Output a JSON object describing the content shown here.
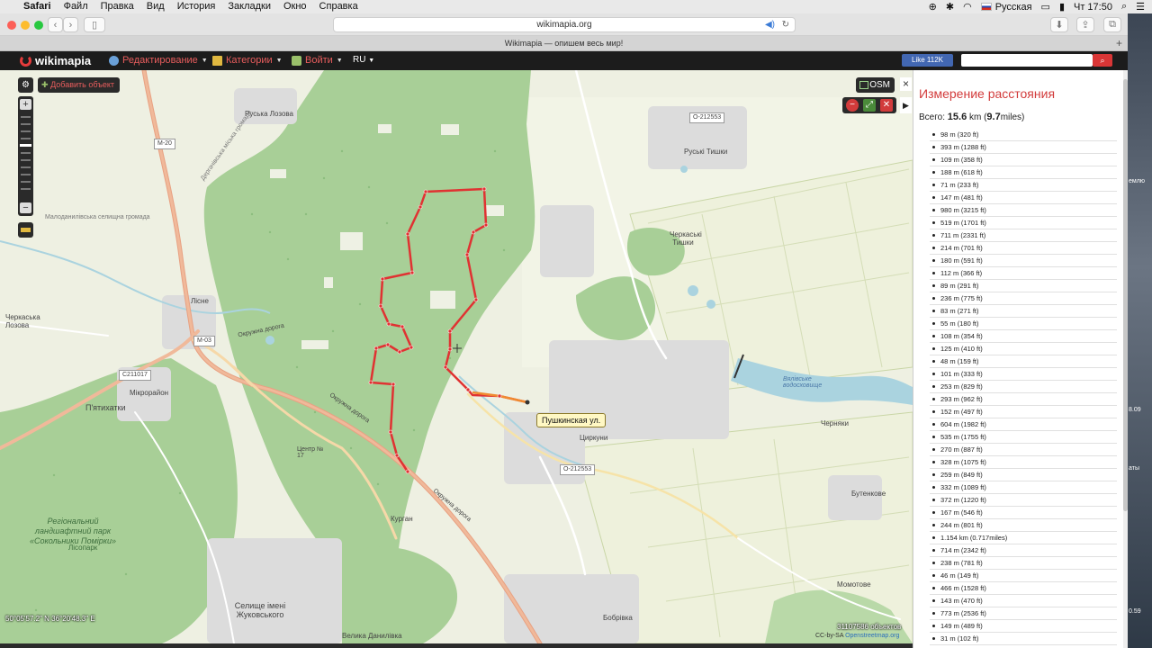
{
  "menubar": {
    "app": "Safari",
    "items": [
      "Файл",
      "Правка",
      "Вид",
      "История",
      "Закладки",
      "Окно",
      "Справка"
    ],
    "input_language": "Русская",
    "clock": "Чт 17:50"
  },
  "browser": {
    "url": "wikimapia.org",
    "tab_title": "Wikimapia — опишем весь мир!"
  },
  "wikimapia": {
    "logo": "wikimapia",
    "menu": [
      {
        "label": "Редактирование",
        "icon": "globe-icon"
      },
      {
        "label": "Категории",
        "icon": "categories-icon"
      },
      {
        "label": "Войти",
        "icon": "login-icon"
      }
    ],
    "lang": "RU",
    "fb_like": "Like 112K",
    "search_placeholder": "",
    "colors": {
      "accent": "#d23b3b",
      "topbar": "#1c1c1c",
      "route": "#e03232",
      "route_segment": "#f08a30",
      "forest": "#7fb27c"
    }
  },
  "map": {
    "add_object": "Добавить объект",
    "osm_button": "OSM",
    "coordinates": "50°05'57.2\" N 36°20'48.3\" E",
    "objects_count": "31107586 объектов",
    "copyright_prefix": "CC-by-SA",
    "copyright_link": "Openstreetmap.org",
    "street_popup": "Пушкинская ул.",
    "labels": {
      "ruska_lozova": "Руська Лозова",
      "m20": "М-20",
      "o212553_top": "О-212553",
      "ruski_tyshky": "Руські Тишки",
      "cherkaski_tyshky": "Черкаські Тишки",
      "malodanylivska": "Малоданилівська селищна громада",
      "derhachi_hromada": "Дергачівська міська громада",
      "lisne": "Лісне",
      "cherkaska_lozova": "Черкаська Лозова",
      "m03": "М-03",
      "c211017": "С211017",
      "mikrorayon": "Мікрорайон",
      "pyatykhatky": "П'ятихатки",
      "okruzhna_1": "Окружна дорога",
      "okruzhna_2": "Окружна дорога",
      "okruzhna_3": "Окружна дорога",
      "tsentr": "Центр № 17",
      "tsyrkuny": "Циркуни",
      "o212553_mid": "О-212553",
      "chernyaky": "Черняки",
      "butenkove": "Бутенкове",
      "momotove": "Момотове",
      "park": "Регіональний ландшафтний парк «Сокольники Помірки»",
      "lisopark": "Лісопарк",
      "kurhan": "Курган",
      "zhukovskoho": "Селище імені Жуковського",
      "velyka_danylivka": "Велика Данилівка",
      "bobrivka": "Бобрівка",
      "reservoir": "Вялівське водосховище"
    }
  },
  "panel": {
    "title": "Измерение расстояния",
    "total_prefix": "Всего: ",
    "total_km": "15.6",
    "total_unit": " km (",
    "total_miles": "9.7",
    "total_suffix": "miles)",
    "segments": [
      "98 m (320 ft)",
      "393 m (1288 ft)",
      "109 m (358 ft)",
      "188 m (618 ft)",
      "71 m (233 ft)",
      "147 m (481 ft)",
      "980 m (3215 ft)",
      "519 m (1701 ft)",
      "711 m (2331 ft)",
      "214 m (701 ft)",
      "180 m (591 ft)",
      "112 m (366 ft)",
      "89 m (291 ft)",
      "236 m (775 ft)",
      "83 m (271 ft)",
      "55 m (180 ft)",
      "108 m (354 ft)",
      "125 m (410 ft)",
      "48 m (159 ft)",
      "101 m (333 ft)",
      "253 m (829 ft)",
      "293 m (962 ft)",
      "152 m (497 ft)",
      "604 m (1982 ft)",
      "535 m (1755 ft)",
      "270 m (887 ft)",
      "328 m (1075 ft)",
      "259 m (849 ft)",
      "332 m (1089 ft)",
      "372 m (1220 ft)",
      "167 m (546 ft)",
      "244 m (801 ft)",
      "1.154 km (0.717miles)",
      "714 m (2342 ft)",
      "238 m (781 ft)",
      "46 m (149 ft)",
      "466 m (1528 ft)",
      "143 m (470 ft)",
      "773 m (2536 ft)",
      "149 m (489 ft)",
      "31 m (102 ft)"
    ]
  },
  "desktop": {
    "texts": [
      "емлю",
      "8.09",
      "аты",
      "0.59"
    ]
  }
}
